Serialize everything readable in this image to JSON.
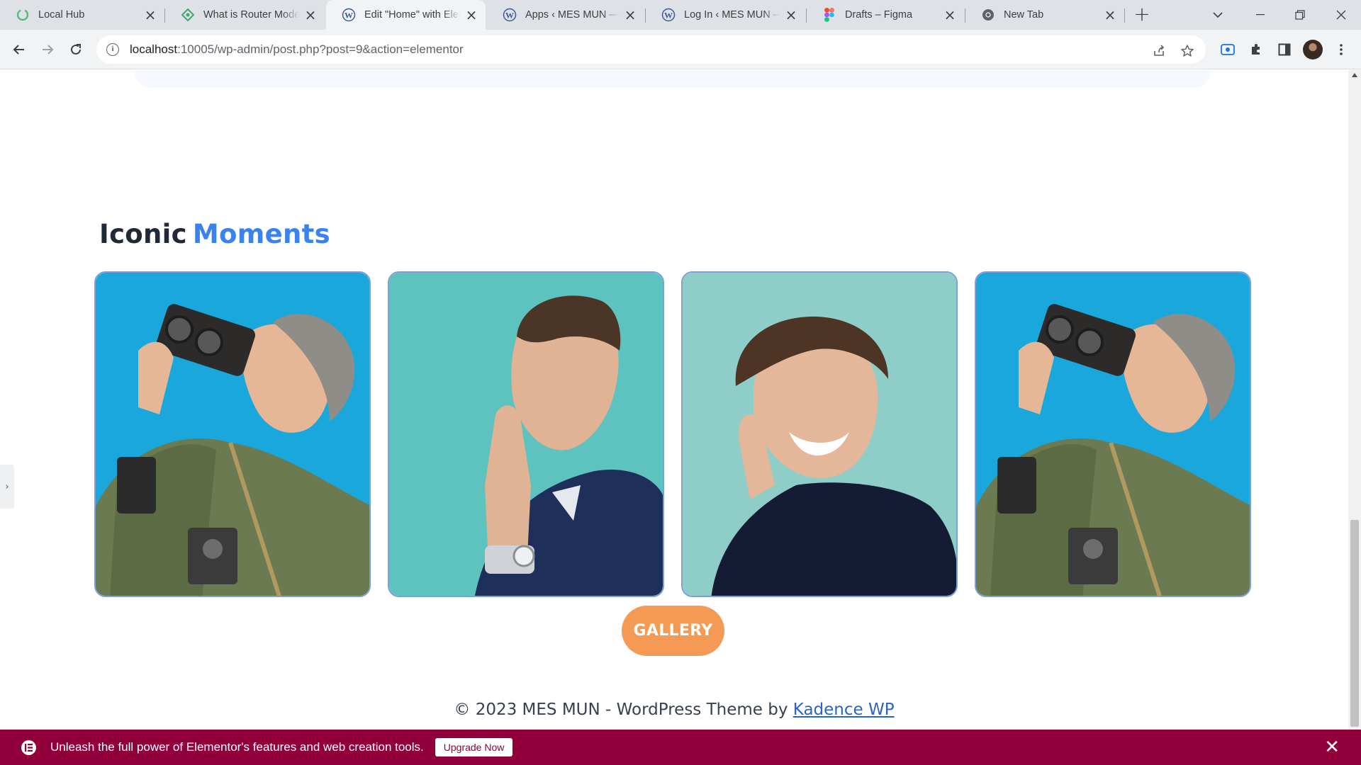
{
  "browser": {
    "tabs": [
      {
        "title": "Local Hub",
        "icon": "local-hub-icon"
      },
      {
        "title": "What is Router Mode",
        "icon": "router-icon"
      },
      {
        "title": "Edit \"Home\" with Elementor",
        "icon": "wordpress-icon",
        "active": true
      },
      {
        "title": "Apps ‹ MES MUN — WordPress",
        "icon": "wordpress-icon"
      },
      {
        "title": "Log In ‹ MES MUN — WordPress",
        "icon": "wordpress-icon"
      },
      {
        "title": "Drafts – Figma",
        "icon": "figma-icon"
      },
      {
        "title": "New Tab",
        "icon": "chrome-icon"
      }
    ],
    "new_tab_label": "+",
    "address": {
      "host": "localhost",
      "rest": ":10005/wp-admin/post.php?post=9&action=elementor"
    }
  },
  "page": {
    "section_title_plain": "Iconic",
    "section_title_accent": "Moments",
    "gallery_button_label": "GALLERY",
    "footer_text": "© 2023 MES MUN - WordPress Theme by",
    "footer_link": "Kadence WP",
    "panel_toggle_label": "›",
    "photos": [
      {
        "name": "photographer with vintage camera",
        "background": "#1aa7dc"
      },
      {
        "name": "man in navy suit thinking",
        "background": "#5ec2be"
      },
      {
        "name": "smiling man in dark sweater",
        "background": "#8fcdc8"
      },
      {
        "name": "photographer with vintage camera",
        "background": "#1aa7dc"
      }
    ]
  },
  "elementor_banner": {
    "message": "Unleash the full power of Elementor's features and web creation tools.",
    "button_label": "Upgrade Now",
    "close_label": "✕",
    "background": "#92003b"
  },
  "colors": {
    "accent_blue": "#3a82f2",
    "button_orange": "#f59a55"
  }
}
